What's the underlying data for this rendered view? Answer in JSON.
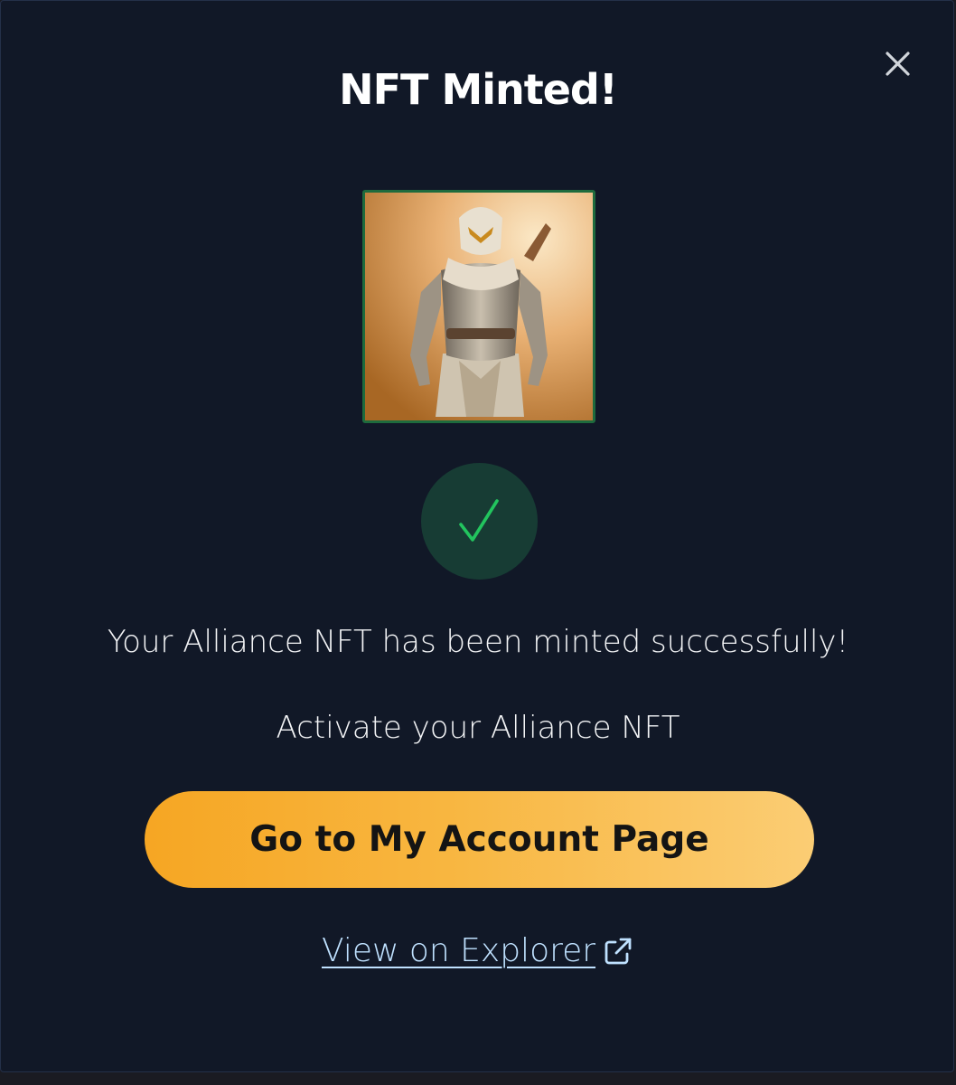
{
  "modal": {
    "title": "NFT Minted!",
    "close_icon": "close-icon",
    "nft_image": "alliance-nft-artwork",
    "status_icon": "checkmark-icon",
    "success_message": "Your Alliance NFT has been minted successfully!",
    "activate_message": "Activate your Alliance NFT",
    "primary_button_label": "Go to My Account Page",
    "explorer_link_label": "View on Explorer",
    "explorer_link_icon": "external-link-icon"
  },
  "colors": {
    "background": "#111827",
    "button_gradient_start": "#f6a623",
    "button_gradient_end": "#fbcd74",
    "success_green": "#22c55e",
    "link_blue": "#bfe1ff",
    "frame_green": "#1e6b3d"
  }
}
